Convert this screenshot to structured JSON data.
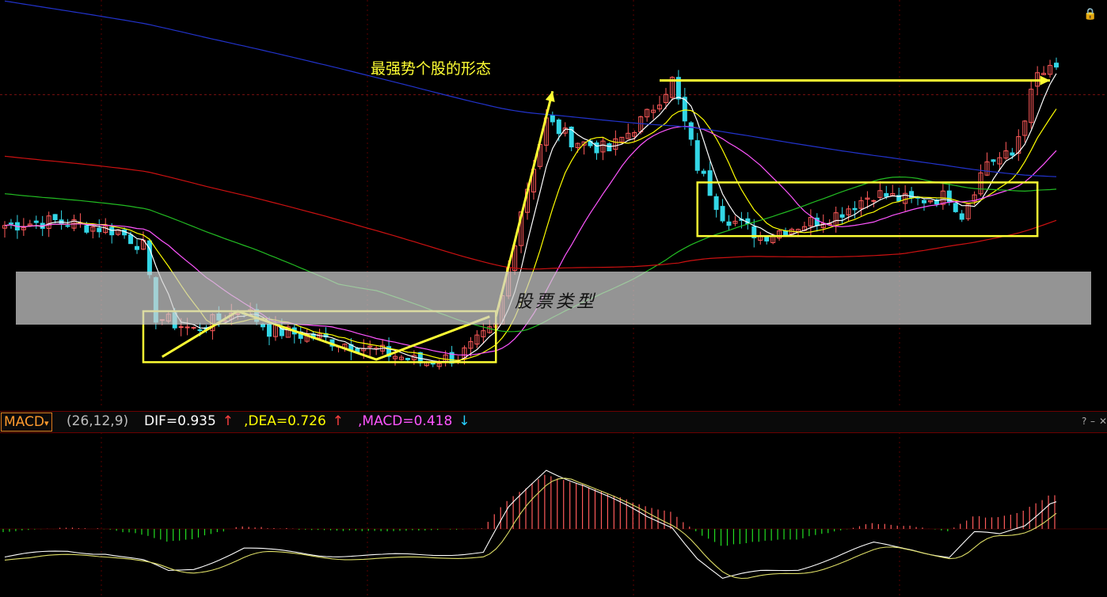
{
  "caption": "最强势个股的形态",
  "watermark": "股票类型",
  "indicator": {
    "name": "MACD",
    "dropdown_mark": "▾",
    "params": "(26,12,9)",
    "dif_label": "DIF=0.935",
    "dea_label": ",DEA=0.726",
    "macd_label": ",MACD=0.418",
    "dif_arrow": "↑",
    "dea_arrow": "↑",
    "macd_arrow": "↓"
  },
  "window_controls": {
    "help": "?",
    "minimize": "–",
    "close": "✕"
  },
  "icons": {
    "lock": "lock-icon"
  },
  "colors": {
    "caption": "#ffff33",
    "candle_up": "#ff5a5a",
    "candle_down": "#33d6e6",
    "ma_white": "#ffffff",
    "ma_yellow": "#ffff00",
    "ma_pink": "#ff55ff",
    "ma_green": "#22bb22",
    "ma_red": "#cc1111",
    "ma_blue": "#2233cc",
    "dif_text": "#ffffff",
    "dea_text": "#ffff00",
    "macd_text": "#ff55ff"
  },
  "chart_data": {
    "type": "candlestick",
    "sessions": 168,
    "price_keypoints": [
      [
        0,
        10.0
      ],
      [
        8,
        10.08
      ],
      [
        18,
        9.9
      ],
      [
        22,
        9.6
      ],
      [
        24,
        8.3
      ],
      [
        30,
        8.05
      ],
      [
        38,
        8.45
      ],
      [
        42,
        8.05
      ],
      [
        48,
        7.95
      ],
      [
        58,
        7.7
      ],
      [
        66,
        7.45
      ],
      [
        72,
        7.55
      ],
      [
        78,
        8.1
      ],
      [
        82,
        10.3
      ],
      [
        86,
        11.95
      ],
      [
        90,
        11.6
      ],
      [
        96,
        11.4
      ],
      [
        102,
        12.05
      ],
      [
        106,
        12.7
      ],
      [
        110,
        11.1
      ],
      [
        114,
        10.2
      ],
      [
        120,
        9.8
      ],
      [
        126,
        10.0
      ],
      [
        132,
        10.2
      ],
      [
        138,
        10.6
      ],
      [
        144,
        10.45
      ],
      [
        150,
        10.55
      ],
      [
        152,
        10.2
      ],
      [
        156,
        11.2
      ],
      [
        160,
        11.3
      ],
      [
        164,
        12.8
      ],
      [
        167,
        12.9
      ]
    ],
    "moving_averages": [
      {
        "period": 5,
        "color": "#ffffff"
      },
      {
        "period": 10,
        "color": "#ffff00"
      },
      {
        "period": 20,
        "color": "#ff55ff"
      },
      {
        "period": 60,
        "color": "#22bb22"
      },
      {
        "period": 120,
        "color": "#cc1111"
      },
      {
        "period": 250,
        "color": "#2233cc"
      }
    ],
    "macd_keypoints": [
      [
        0,
        -0.05
      ],
      [
        10,
        0.02
      ],
      [
        16,
        0.0
      ],
      [
        22,
        -0.1
      ],
      [
        26,
        -0.22
      ],
      [
        30,
        -0.18
      ],
      [
        38,
        0.05
      ],
      [
        42,
        0.02
      ],
      [
        50,
        -0.02
      ],
      [
        60,
        -0.04
      ],
      [
        70,
        -0.01
      ],
      [
        76,
        0.0
      ],
      [
        80,
        0.5
      ],
      [
        86,
        0.95
      ],
      [
        92,
        0.78
      ],
      [
        98,
        0.55
      ],
      [
        102,
        0.4
      ],
      [
        106,
        0.3
      ],
      [
        110,
        -0.05
      ],
      [
        114,
        -0.3
      ],
      [
        120,
        -0.22
      ],
      [
        126,
        -0.18
      ],
      [
        132,
        -0.05
      ],
      [
        138,
        0.1
      ],
      [
        144,
        0.05
      ],
      [
        150,
        -0.05
      ],
      [
        154,
        0.22
      ],
      [
        158,
        0.2
      ],
      [
        162,
        0.32
      ],
      [
        166,
        0.58
      ],
      [
        167,
        0.6
      ]
    ],
    "current": {
      "dif": 0.935,
      "dea": 0.726,
      "macd": 0.418
    },
    "annotations": {
      "boxes": [
        {
          "from_session": 22,
          "to_session": 78,
          "low": 7.45,
          "high": 8.4
        },
        {
          "from_session": 110,
          "to_session": 164,
          "low": 9.8,
          "high": 10.8
        }
      ],
      "zigzag": [
        [
          25,
          7.55
        ],
        [
          37,
          8.4
        ],
        [
          59,
          7.5
        ],
        [
          77,
          8.3
        ]
      ],
      "breakout_arrow": [
        [
          78,
          8.3
        ],
        [
          87,
          12.5
        ]
      ],
      "level_line": {
        "from_session": 104,
        "to_session": 166,
        "price": 12.7
      }
    }
  }
}
